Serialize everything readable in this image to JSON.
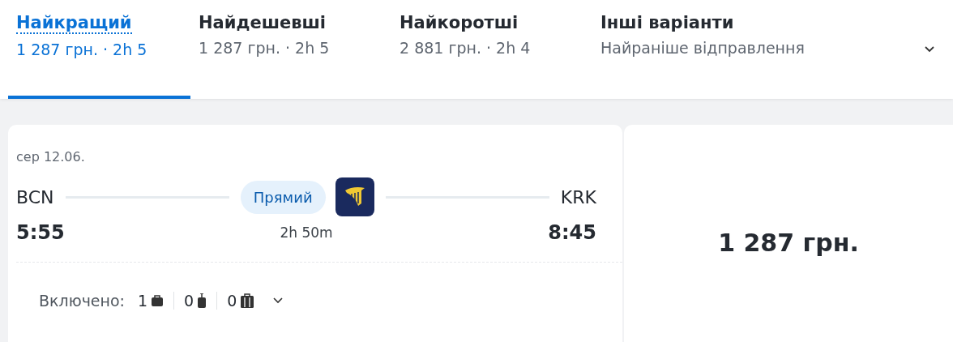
{
  "tabs": [
    {
      "label": "Найкращий",
      "subtitle": "1 287 грн. · 2h 5",
      "selected": true
    },
    {
      "label": "Найдешевші",
      "subtitle": "1 287 грн. · 2h 5",
      "selected": false
    },
    {
      "label": "Найкоротші",
      "subtitle": "2 881 грн. · 2h 4",
      "selected": false
    },
    {
      "label": "Інші варіанти",
      "subtitle": "Найраніше відправлення",
      "selected": false
    }
  ],
  "flight": {
    "date": "сер 12.06.",
    "origin": "BCN",
    "destination": "KRK",
    "departure": "5:55",
    "arrival": "8:45",
    "stops_badge": "Прямий",
    "duration": "2h 50m"
  },
  "baggage": {
    "label": "Включено:",
    "items": [
      {
        "kind": "personal",
        "count": "1"
      },
      {
        "kind": "cabin",
        "count": "0"
      },
      {
        "kind": "checked",
        "count": "0"
      }
    ]
  },
  "price": "1 287 грн."
}
